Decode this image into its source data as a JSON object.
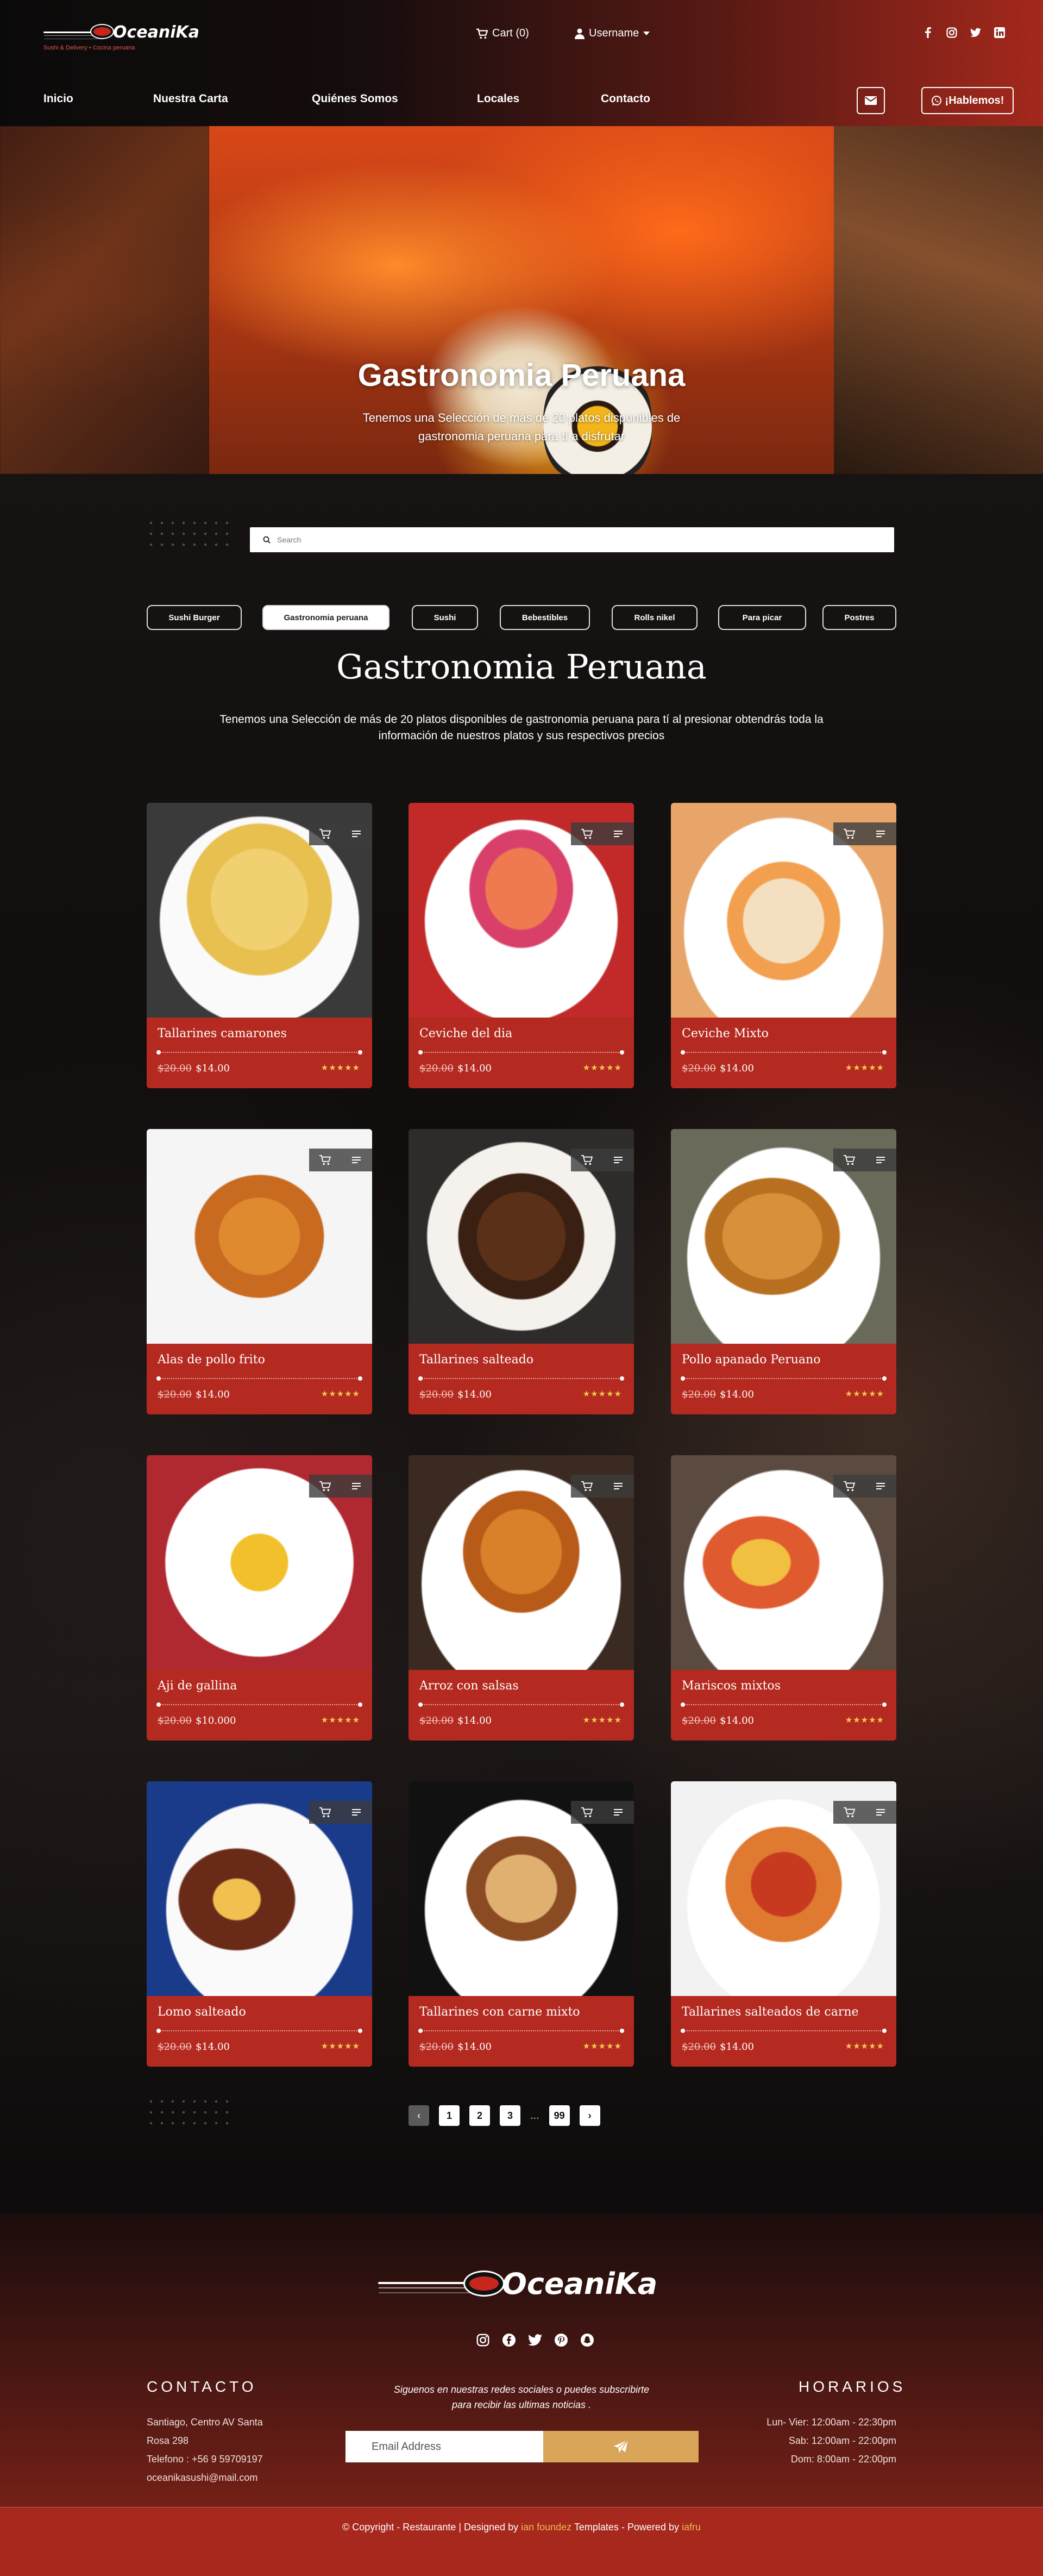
{
  "header": {
    "brand": "OceaniKa",
    "brand_tagline": "Sushi & Delivery • Cocina peruana",
    "cart_label": "Cart (0)",
    "user_label": "Username",
    "social_icons": [
      "facebook-icon",
      "instagram-icon",
      "twitter-icon",
      "linkedin-icon"
    ],
    "nav": [
      "Inicio",
      "Nuestra Carta",
      "Quiénes Somos",
      "Locales",
      "Contacto"
    ],
    "talk_button": "¡Hablemos!"
  },
  "hero": {
    "title": "Gastronomia Peruana",
    "subtitle": "Tenemos una Selección de más de 20 platos disponibles de gastronomia peruana para tí a disfrutar"
  },
  "search": {
    "placeholder": "Search"
  },
  "filters": [
    {
      "label": "Sushi Burger",
      "active": false
    },
    {
      "label": "Gastronomia peruana",
      "active": true
    },
    {
      "label": "Sushi",
      "active": false
    },
    {
      "label": "Bebestibles",
      "active": false
    },
    {
      "label": "Rolls nikel",
      "active": false
    },
    {
      "label": "Para picar",
      "active": false
    },
    {
      "label": "Postres",
      "active": false
    }
  ],
  "section": {
    "title": "Gastronomia Peruana",
    "description": "Tenemos una Selección de más de 20 platos disponibles de gastronomia peruana para tí al presionar obtendrás toda la información de nuestros platos y sus respectivos precios"
  },
  "products": [
    {
      "name": "Tallarines camarones",
      "old_price": "$20.00",
      "price": "$14.00",
      "rating": 5
    },
    {
      "name": "Ceviche del dia",
      "old_price": "$20.00",
      "price": "$14.00",
      "rating": 5
    },
    {
      "name": "Ceviche Mixto",
      "old_price": "$20.00",
      "price": "$14.00",
      "rating": 5
    },
    {
      "name": "Alas de pollo frito",
      "old_price": "$20.00",
      "price": "$14.00",
      "rating": 5
    },
    {
      "name": "Tallarines salteado",
      "old_price": "$20.00",
      "price": "$14.00",
      "rating": 5
    },
    {
      "name": "Pollo apanado Peruano",
      "old_price": "$20.00",
      "price": "$14.00",
      "rating": 5
    },
    {
      "name": "Aji de gallina",
      "old_price": "$20.00",
      "price": "$10.000",
      "rating": 5
    },
    {
      "name": "Arroz con salsas",
      "old_price": "$20.00",
      "price": "$14.00",
      "rating": 5
    },
    {
      "name": "Mariscos mixtos",
      "old_price": "$20.00",
      "price": "$14.00",
      "rating": 5
    },
    {
      "name": "Lomo salteado",
      "old_price": "$20.00",
      "price": "$14.00",
      "rating": 5
    },
    {
      "name": "Tallarines con carne mixto",
      "old_price": "$20.00",
      "price": "$14.00",
      "rating": 5
    },
    {
      "name": "Tallarines salteados de carne",
      "old_price": "$20.00",
      "price": "$14.00",
      "rating": 5
    }
  ],
  "pagination": {
    "pages": [
      "1",
      "2",
      "3"
    ],
    "ellipsis": "...",
    "last": "99",
    "prev": "‹",
    "next": "›"
  },
  "footer": {
    "brand": "OceaniKa",
    "social_icons": [
      "instagram-icon",
      "facebook-icon",
      "twitter-icon",
      "pinterest-icon",
      "snapchat-icon"
    ],
    "contact_title": "CONTACTO",
    "contact_lines": [
      "Santiago, Centro AV Santa",
      "Rosa 298",
      "Telefono : +56 9 59709197",
      "oceanikasushi@mail.com"
    ],
    "newsletter_text": "Siguenos en nuestras redes sociales o puedes subscribirte para recibir las ultimas noticias .",
    "email_placeholder": "Email Address",
    "hours_title": "HORARIOS",
    "hours_lines": [
      "Lun- Vier: 12:00am - 22:30pm",
      "Sab: 12:00am - 22:00pm",
      "Dom: 8:00am - 22:00pm"
    ],
    "copyright_prefix": "© Copyright - Restaurante | Designed by",
    "designer": "ian foundez",
    "copyright_middle": "Templates - Powered by",
    "powered": "iafru"
  },
  "colors": {
    "accent": "#b42a20",
    "gold": "#d9a558",
    "stars": "#f2c94c"
  }
}
